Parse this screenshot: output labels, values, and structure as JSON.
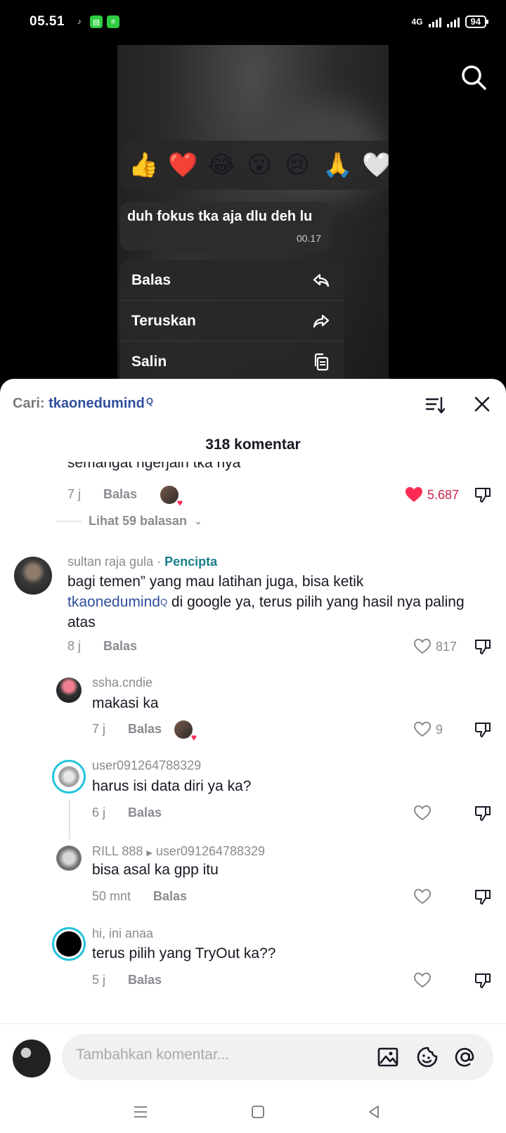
{
  "status_bar": {
    "time": "05.51",
    "network": "4G",
    "battery": "94"
  },
  "video": {
    "search_icon": "search-icon"
  },
  "reactions": [
    "👍",
    "❤️",
    "😂",
    "😮",
    "😢",
    "🙏",
    "🤍"
  ],
  "message_bubble": {
    "text": "duh fokus tka aja dlu deh lu",
    "time": "00.17"
  },
  "context_menu": [
    {
      "label": "Balas",
      "icon": "reply-icon"
    },
    {
      "label": "Teruskan",
      "icon": "forward-icon"
    },
    {
      "label": "Salin",
      "icon": "copy-icon"
    }
  ],
  "comments_header": {
    "search_prefix": "Cari:",
    "search_term": "tkaonedumind",
    "count_label": "318 komentar"
  },
  "top_comment": {
    "partial_text": "semangat ngerjain tka nya",
    "time": "7 j",
    "reply_label": "Balas",
    "likes": "5.687",
    "view_replies": "Lihat 59 balasan"
  },
  "comments": [
    {
      "user": "sultan raja gula",
      "badge": "Pencipta",
      "text_before": "bagi temen” yang mau latihan juga, bisa ketik",
      "link": "tkaonedumind",
      "text_after": " di google ya, terus pilih yang hasil nya paling atas",
      "time": "8 j",
      "reply_label": "Balas",
      "likes": "817"
    },
    {
      "user": "ssha.cndie",
      "text": "makasi ka",
      "time": "7 j",
      "reply_label": "Balas",
      "likes": "9"
    },
    {
      "user": "user091264788329",
      "text": "harus isi data diri ya ka?",
      "time": "6 j",
      "reply_label": "Balas",
      "likes": ""
    },
    {
      "user": "RILL 888",
      "reply_to": "user091264788329",
      "text": "bisa asal ka gpp itu",
      "time": "50 mnt",
      "reply_label": "Balas",
      "likes": ""
    },
    {
      "user": "hi, ini anaa",
      "text": "terus pilih yang TryOut ka??",
      "time": "5 j",
      "reply_label": "Balas",
      "likes": ""
    }
  ],
  "input": {
    "placeholder": "Tambahkan komentar..."
  },
  "colors": {
    "like_red": "#fe2c55",
    "link_blue": "#2f4f9c",
    "creator_teal": "#1a7f8c"
  }
}
